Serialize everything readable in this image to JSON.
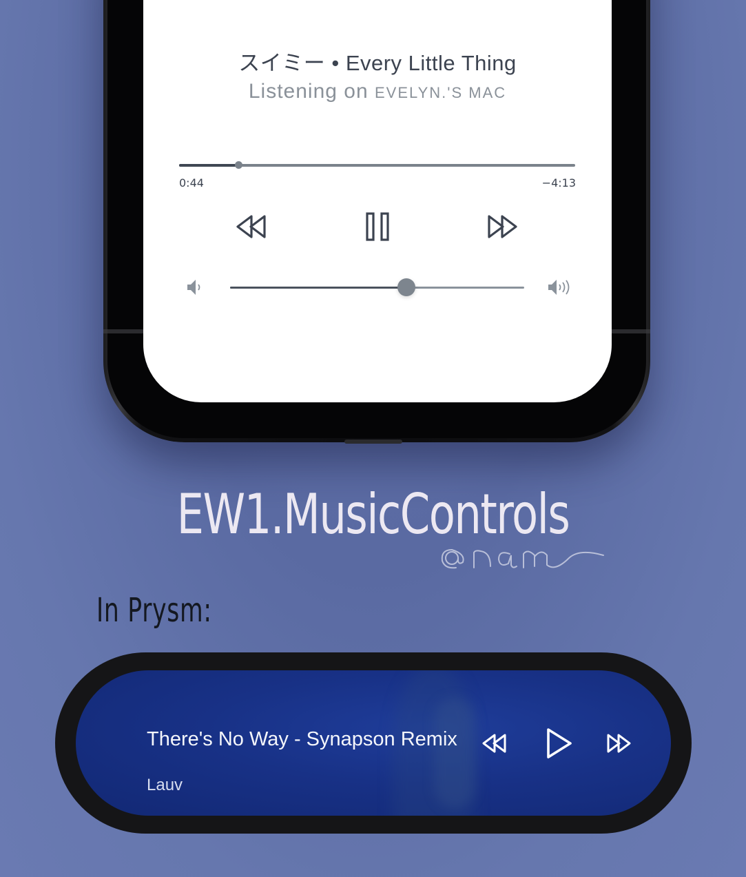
{
  "now_playing": {
    "title": "スイミー • Every Little Thing",
    "listening_prefix": "Listening on ",
    "device": "EVELYN.'S MAC",
    "elapsed": "0:44",
    "remaining": "−4:13",
    "progress": 0.15,
    "volume": 0.6
  },
  "controls": {
    "rewind_icon": "rewind-icon",
    "pause_icon": "pause-icon",
    "forward_icon": "fast-forward-icon",
    "volume_low_icon": "volume-low-icon",
    "volume_high_icon": "volume-high-icon"
  },
  "promo": {
    "tweak_name": "EW1.MusicControls",
    "signature": "@nam",
    "prysm_label": "In Prysm:"
  },
  "prysm_widget": {
    "title": "There's No Way - Synapson Remix",
    "artist": "Lauv",
    "rewind_icon": "rewind-icon",
    "play_icon": "play-icon",
    "forward_icon": "fast-forward-icon"
  },
  "colors": {
    "background": "#5f6fa8",
    "screen": "#ffffff",
    "text_dark": "#3c4350",
    "text_muted": "#8a9199",
    "pill_blue": "#183186"
  }
}
